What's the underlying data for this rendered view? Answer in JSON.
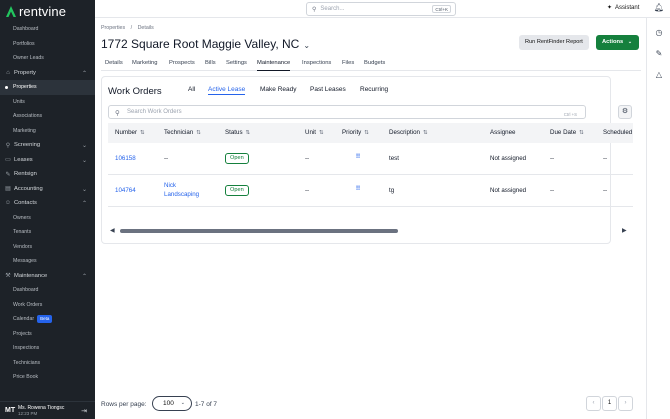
{
  "app": {
    "name": "rentvine"
  },
  "sidebar": {
    "top_items": [
      {
        "label": "Dashboard"
      },
      {
        "label": "Portfolios"
      },
      {
        "label": "Owner Leads"
      }
    ],
    "sections": [
      {
        "label": "Property",
        "icon": "home-icon",
        "expanded": true,
        "items": [
          {
            "label": "Properties",
            "active": true
          },
          {
            "label": "Units"
          },
          {
            "label": "Associations"
          },
          {
            "label": "Marketing"
          }
        ]
      },
      {
        "label": "Screening",
        "icon": "screening-icon",
        "expanded": false,
        "items": []
      },
      {
        "label": "Leases",
        "icon": "leases-icon",
        "expanded": false,
        "items": []
      },
      {
        "label": "Rentsign",
        "icon": "rentsign-icon",
        "expanded": false,
        "items": []
      },
      {
        "label": "Accounting",
        "icon": "accounting-icon",
        "expanded": false,
        "items": []
      },
      {
        "label": "Contacts",
        "icon": "contacts-icon",
        "expanded": true,
        "items": [
          {
            "label": "Owners"
          },
          {
            "label": "Tenants"
          },
          {
            "label": "Vendors"
          },
          {
            "label": "Messages"
          }
        ]
      },
      {
        "label": "Maintenance",
        "icon": "wrench-icon",
        "expanded": true,
        "items": [
          {
            "label": "Dashboard"
          },
          {
            "label": "Work Orders"
          },
          {
            "label": "Calendar",
            "badge": "Beta"
          },
          {
            "label": "Projects"
          },
          {
            "label": "Inspections"
          },
          {
            "label": "Technicians"
          },
          {
            "label": "Price Book"
          }
        ]
      }
    ],
    "user": {
      "initials": "MT",
      "name": "Ms. Rowena Tiongsc",
      "time": "12:23 PM"
    }
  },
  "topbar": {
    "search_placeholder": "Search...",
    "search_shortcut": "Ctrl+K",
    "assistant_label": "Assistant"
  },
  "breadcrumb": {
    "parent": "Properties",
    "separator": "/",
    "current": "Details"
  },
  "page": {
    "title": "1772 Square Root Maggie Valley, NC",
    "report_button": "Run RentFinder Report",
    "actions_button": "Actions"
  },
  "tabs": [
    {
      "label": "Details"
    },
    {
      "label": "Marketing"
    },
    {
      "label": "Prospects"
    },
    {
      "label": "Bills"
    },
    {
      "label": "Settings"
    },
    {
      "label": "Maintenance",
      "active": true
    },
    {
      "label": "Inspections"
    },
    {
      "label": "Files"
    },
    {
      "label": "Budgets"
    }
  ],
  "work_orders": {
    "title": "Work Orders",
    "filters": [
      {
        "label": "All"
      },
      {
        "label": "Active Lease",
        "active": true
      },
      {
        "label": "Make Ready"
      },
      {
        "label": "Past Leases"
      },
      {
        "label": "Recurring"
      }
    ],
    "search_placeholder": "Search Work Orders",
    "search_shortcut": "Ctrl +S",
    "columns": [
      "Number",
      "Technician",
      "Status",
      "Unit",
      "Priority",
      "Description",
      "Assignee",
      "Due Date",
      "Scheduled"
    ],
    "rows": [
      {
        "number": "106158",
        "technician": "--",
        "status": "Open",
        "unit": "--",
        "priority": "!!",
        "description": "test",
        "assignee": "Not assigned",
        "due_date": "--",
        "scheduled": "--"
      },
      {
        "number": "104764",
        "technician": "Nick Landscaping",
        "technician_line1": "Nick",
        "technician_line2": "Landscaping",
        "status": "Open",
        "unit": "--",
        "priority": "!!",
        "description": "tg",
        "assignee": "Not assigned",
        "due_date": "--",
        "scheduled": "--"
      }
    ]
  },
  "pagination": {
    "rows_label": "Rows per page:",
    "rows_value": "100",
    "range": "1-7 of 7",
    "current_page": "1"
  }
}
